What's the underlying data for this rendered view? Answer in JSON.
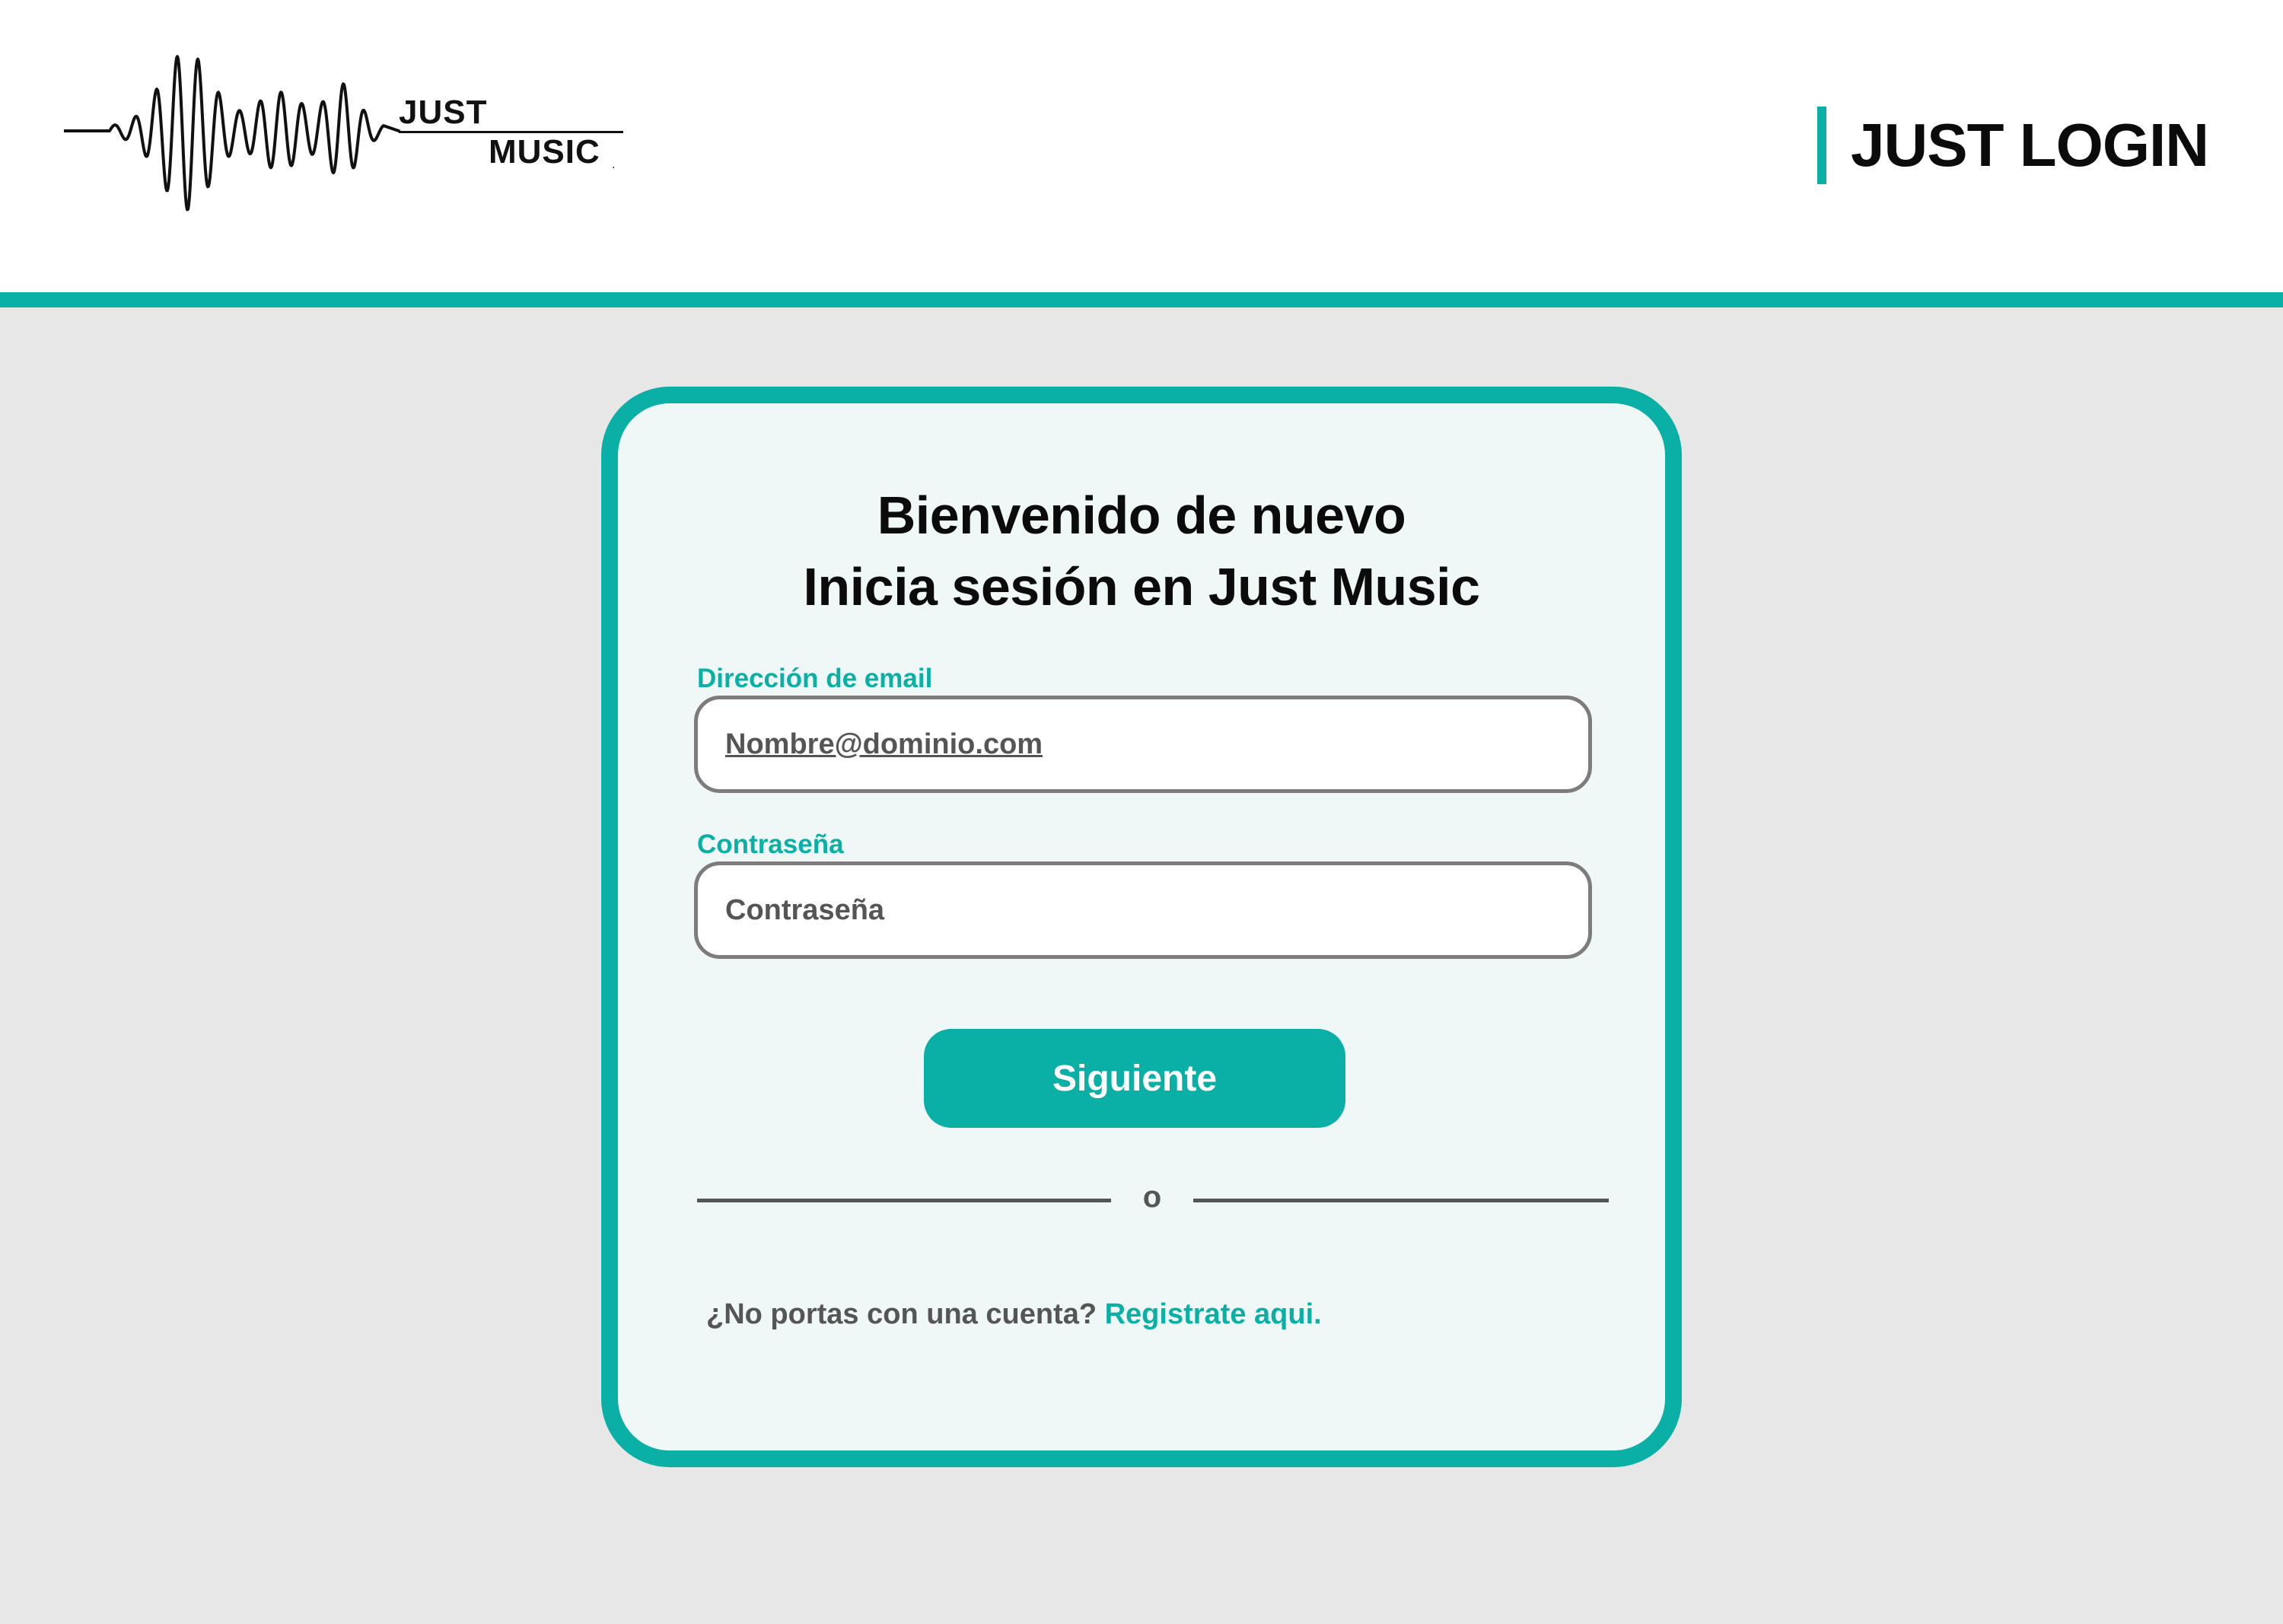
{
  "header": {
    "logo": {
      "line1": "JUST",
      "line2": "MUSIC",
      "mark": "."
    },
    "title": "JUST LOGIN"
  },
  "login": {
    "heading_line1": "Bienvenido de nuevo",
    "heading_line2": "Inicia sesión en Just Music",
    "email_label": "Dirección de email",
    "email_placeholder": "Nombre@dominio.com",
    "password_label": "Contraseña",
    "password_placeholder": "Contraseña",
    "submit_label": "Siguiente",
    "divider_text": "o",
    "register_prompt": "¿No portas con una cuenta?",
    "register_link": "Registrate aqui."
  },
  "colors": {
    "accent": "#0aafa6",
    "background": "#e7e7e7",
    "card_background": "#eff8f7",
    "input_border": "#7e7b7d",
    "text_dark": "#0b0b0b",
    "text_muted": "#555555"
  },
  "icons": [
    "soundwave-logo-icon"
  ]
}
